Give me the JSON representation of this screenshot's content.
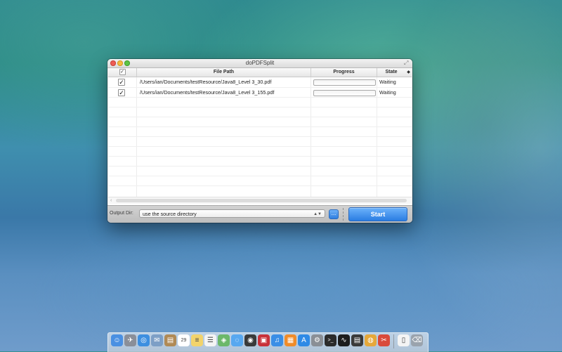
{
  "window": {
    "title": "doPDFSplit"
  },
  "table": {
    "columns": {
      "checkbox": "✓",
      "file_path": "File Path",
      "progress": "Progress",
      "state": "State",
      "corner": "◆"
    },
    "rows": [
      {
        "checked": "✓",
        "file_path": "/Users/ian/Documents/testResource/Java8_Level 3_30.pdf",
        "progress": 0,
        "state": "Waiting"
      },
      {
        "checked": "✓",
        "file_path": "/Users/ian/Documents/testResource/Java8_Level 3_155.pdf",
        "progress": 0,
        "state": "Waiting"
      }
    ]
  },
  "bottom_bar": {
    "output_dir_label": "Output Dir:",
    "output_dir_value": "use the source directory",
    "browse_label": "...",
    "start_label": "Start"
  },
  "dock": {
    "icons": [
      {
        "name": "finder-icon",
        "color": "#4a90e2",
        "glyph": "☺"
      },
      {
        "name": "launchpad-icon",
        "color": "#8a8f99",
        "glyph": "✈"
      },
      {
        "name": "safari-icon",
        "color": "#3d8fe0",
        "glyph": "◎"
      },
      {
        "name": "mail-icon",
        "color": "#7d9fc6",
        "glyph": "✉"
      },
      {
        "name": "contacts-icon",
        "color": "#b08a56",
        "glyph": "▤"
      },
      {
        "name": "calendar-icon",
        "color": "#ffffff",
        "glyph": "29"
      },
      {
        "name": "notes-icon",
        "color": "#f2d36b",
        "glyph": "≡"
      },
      {
        "name": "reminders-icon",
        "color": "#f4f4f4",
        "glyph": "☰"
      },
      {
        "name": "maps-icon",
        "color": "#6cb86a",
        "glyph": "◈"
      },
      {
        "name": "messages-icon",
        "color": "#58a8f0",
        "glyph": "◌"
      },
      {
        "name": "facetime-icon",
        "color": "#3a3a3a",
        "glyph": "◉"
      },
      {
        "name": "photo-booth-icon",
        "color": "#c8323a",
        "glyph": "▣"
      },
      {
        "name": "itunes-icon",
        "color": "#3a8ee6",
        "glyph": "♫"
      },
      {
        "name": "ibooks-icon",
        "color": "#f08c2a",
        "glyph": "▦"
      },
      {
        "name": "app-store-icon",
        "color": "#2f8ae6",
        "glyph": "A"
      },
      {
        "name": "system-preferences-icon",
        "color": "#8a8f96",
        "glyph": "⚙"
      },
      {
        "name": "terminal-icon",
        "color": "#2b2b2b",
        "glyph": ">_"
      },
      {
        "name": "activity-monitor-icon",
        "color": "#1d1d1d",
        "glyph": "∿"
      },
      {
        "name": "console-icon",
        "color": "#3a3a3a",
        "glyph": "▤"
      },
      {
        "name": "chrome-icon",
        "color": "#e6a83a",
        "glyph": "◍"
      },
      {
        "name": "dopdfsplit-icon",
        "color": "#d94a3a",
        "glyph": "✂"
      },
      {
        "name": "document-icon",
        "color": "#f4f4f4",
        "glyph": "▯"
      },
      {
        "name": "trash-icon",
        "color": "#9aa3ad",
        "glyph": "⌫"
      }
    ]
  }
}
